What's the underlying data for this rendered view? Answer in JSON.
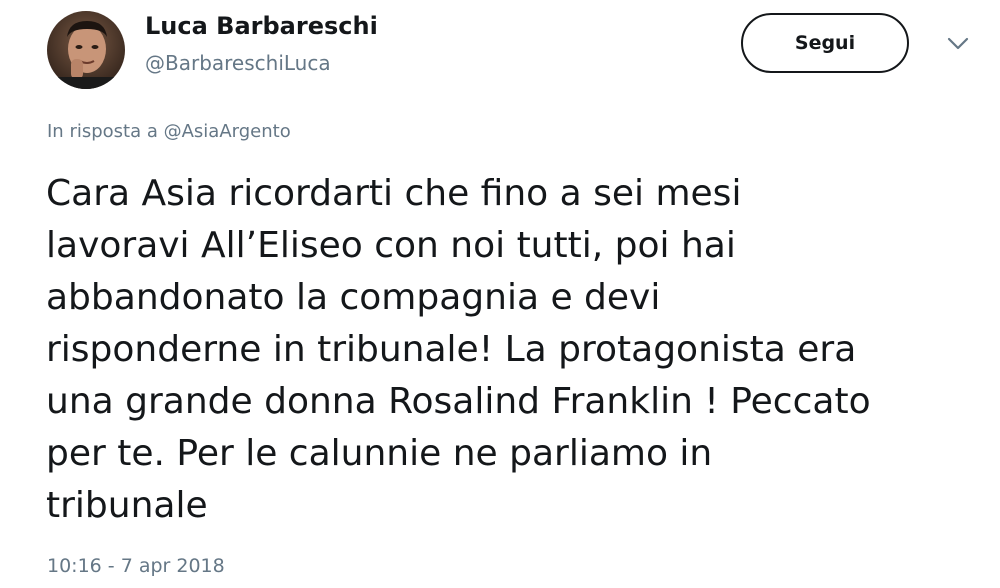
{
  "author": {
    "display_name": "Luca Barbareschi",
    "handle": "@BarbareschiLuca"
  },
  "follow_button": {
    "label": "Segui"
  },
  "reply_context": {
    "prefix": "In risposta a",
    "mention": "@AsiaArgento"
  },
  "tweet": {
    "lines": [
      "Cara Asia ricordarti che fino a sei mesi",
      "lavoravi All’Eliseo con noi tutti, poi hai",
      "abbandonato la compagnia e devi",
      "risponderne in tribunale! La protagonista era",
      "una grande donna Rosalind Franklin ! Peccato",
      "per te. Per le calunnie ne parliamo in",
      "tribunale"
    ],
    "timestamp": "10:16 - 7 apr 2018"
  },
  "icons": {
    "menu_caret": "chevron-down-icon",
    "avatar": "profile-photo"
  },
  "colors": {
    "text_primary": "#14171a",
    "text_secondary": "#657786",
    "background": "#ffffff"
  }
}
